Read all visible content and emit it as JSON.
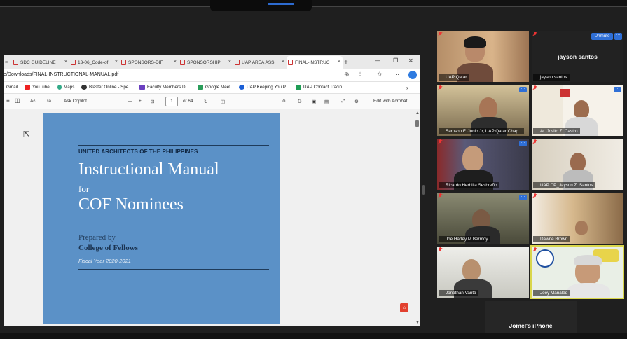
{
  "browser": {
    "tabs": [
      {
        "label": "SDC GUIDELINE"
      },
      {
        "label": "13-06_Code-of"
      },
      {
        "label": "SPONSORS-DIF"
      },
      {
        "label": "SPONSORSHIP"
      },
      {
        "label": "UAP AREA ASS"
      },
      {
        "label": "FINAL-INSTRUC",
        "active": true
      }
    ],
    "new_tab": "+",
    "address": "e/Downloads/FINAL-INSTRUCTIONAL-MANUAL.pdf",
    "bookmarks": [
      {
        "label": "Gmail",
        "color": "#d44"
      },
      {
        "label": "YouTube",
        "color": "#e22"
      },
      {
        "label": "Maps",
        "color": "#3a8"
      },
      {
        "label": "Blaster Online - Spe...",
        "color": "#333"
      },
      {
        "label": "Faculty Members D...",
        "color": "#6a3fc0"
      },
      {
        "label": "Google Meet",
        "color": "#2a9d5a"
      },
      {
        "label": "UAP Keeping You P...",
        "color": "#1b5fd6"
      },
      {
        "label": "UAP Contact Tracin...",
        "color": "#1f9d55"
      }
    ],
    "pdf_toolbar": {
      "ask_copilot": "Ask Copilot",
      "page_current": "1",
      "page_total": "of 64",
      "edit_acrobat": "Edit with Acrobat",
      "minus": "—",
      "plus": "+"
    }
  },
  "document": {
    "org": "UNITED ARCHITECTS OF THE PHILIPPINES",
    "title": "Instructional Manual",
    "for": "for",
    "subtitle": "COF Nominees",
    "prepared_by": "Prepared by",
    "college": "College of Fellows",
    "fiscal": "Fiscal Year 2020-2021"
  },
  "meeting": {
    "unmute_label": "Unmute",
    "participants": [
      {
        "name": "UAP Qatar"
      },
      {
        "name": "jayson santos",
        "display": "jayson santos"
      },
      {
        "name": "Samson F. Junio Jr, UAP Qatar Chap..."
      },
      {
        "name": "Ar. Jovito Z. Castro"
      },
      {
        "name": "Ricardo Herbilla Sesbreño"
      },
      {
        "name": "UAP CP_Jayson Z. Santos"
      },
      {
        "name": "Joe Harley M Bermoy"
      },
      {
        "name": "Dawne Brown"
      },
      {
        "name": "Jonathan Vanta"
      },
      {
        "name": "Joey Manalad"
      },
      {
        "name": "Jomel's iPhone",
        "display": "Jomel's iPhone"
      }
    ]
  },
  "colors": {
    "page_blue": "#5b91c7",
    "accent": "#2f6fd6",
    "active_speaker": "#d9d64a"
  }
}
